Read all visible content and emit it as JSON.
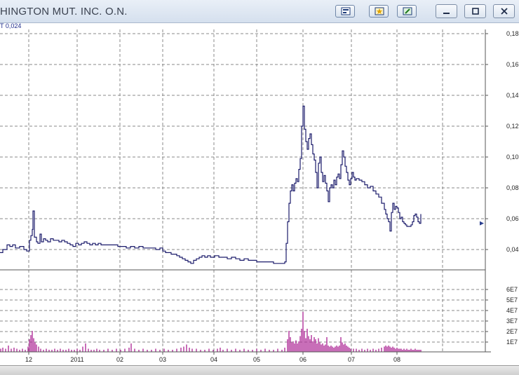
{
  "window": {
    "title": "HINGTON MUT. INC. O.N.",
    "cursor_readout": "T  0,024"
  },
  "toolbar": {
    "buttons": [
      {
        "name": "chart-settings-button",
        "icon": "chart-settings-icon"
      },
      {
        "name": "favorite-button",
        "icon": "star-icon"
      },
      {
        "name": "draw-tool-button",
        "icon": "pencil-icon"
      }
    ],
    "window_controls": [
      "minimize-icon",
      "restore-icon",
      "close-icon"
    ]
  },
  "chart_data": [
    {
      "type": "line",
      "title": "",
      "xlabel": "",
      "ylabel": "",
      "x_ticks": [
        "12",
        "2011",
        "02",
        "03",
        "04",
        "05",
        "06",
        "07",
        "08"
      ],
      "y_ticks": [
        "0,18",
        "0,16",
        "0,14",
        "0,12",
        "0,10",
        "0,08",
        "0,06",
        "0,04"
      ],
      "ylim": [
        0.03,
        0.185
      ],
      "grid": true,
      "last_value_marker": 0.057,
      "price_series": [
        [
          0,
          0.038
        ],
        [
          4,
          0.04
        ],
        [
          8,
          0.04
        ],
        [
          10,
          0.043
        ],
        [
          14,
          0.042
        ],
        [
          18,
          0.043
        ],
        [
          22,
          0.041
        ],
        [
          28,
          0.042
        ],
        [
          34,
          0.04
        ],
        [
          38,
          0.039
        ],
        [
          40,
          0.039
        ],
        [
          42,
          0.046
        ],
        [
          44,
          0.049
        ],
        [
          46,
          0.053
        ],
        [
          47,
          0.065
        ],
        [
          49,
          0.048
        ],
        [
          52,
          0.045
        ],
        [
          54,
          0.044
        ],
        [
          57,
          0.05
        ],
        [
          59,
          0.045
        ],
        [
          62,
          0.047
        ],
        [
          65,
          0.046
        ],
        [
          68,
          0.045
        ],
        [
          72,
          0.047
        ],
        [
          76,
          0.046
        ],
        [
          80,
          0.046
        ],
        [
          84,
          0.045
        ],
        [
          88,
          0.046
        ],
        [
          92,
          0.045
        ],
        [
          96,
          0.044
        ],
        [
          100,
          0.043
        ],
        [
          104,
          0.042
        ],
        [
          108,
          0.044
        ],
        [
          112,
          0.043
        ],
        [
          116,
          0.044
        ],
        [
          120,
          0.045
        ],
        [
          124,
          0.044
        ],
        [
          128,
          0.043
        ],
        [
          132,
          0.044
        ],
        [
          136,
          0.043
        ],
        [
          140,
          0.044
        ],
        [
          144,
          0.043
        ],
        [
          150,
          0.043
        ],
        [
          156,
          0.043
        ],
        [
          162,
          0.043
        ],
        [
          168,
          0.042
        ],
        [
          174,
          0.042
        ],
        [
          180,
          0.041
        ],
        [
          186,
          0.042
        ],
        [
          192,
          0.041
        ],
        [
          198,
          0.042
        ],
        [
          204,
          0.041
        ],
        [
          210,
          0.041
        ],
        [
          216,
          0.041
        ],
        [
          222,
          0.04
        ],
        [
          228,
          0.041
        ],
        [
          232,
          0.039
        ],
        [
          236,
          0.038
        ],
        [
          240,
          0.038
        ],
        [
          244,
          0.037
        ],
        [
          248,
          0.037
        ],
        [
          252,
          0.036
        ],
        [
          256,
          0.035
        ],
        [
          260,
          0.034
        ],
        [
          264,
          0.033
        ],
        [
          268,
          0.032
        ],
        [
          272,
          0.031
        ],
        [
          276,
          0.033
        ],
        [
          280,
          0.034
        ],
        [
          284,
          0.035
        ],
        [
          288,
          0.036
        ],
        [
          292,
          0.035
        ],
        [
          296,
          0.036
        ],
        [
          300,
          0.035
        ],
        [
          306,
          0.036
        ],
        [
          312,
          0.035
        ],
        [
          318,
          0.035
        ],
        [
          324,
          0.034
        ],
        [
          330,
          0.035
        ],
        [
          336,
          0.034
        ],
        [
          342,
          0.033
        ],
        [
          348,
          0.034
        ],
        [
          354,
          0.033
        ],
        [
          360,
          0.033
        ],
        [
          366,
          0.032
        ],
        [
          372,
          0.032
        ],
        [
          378,
          0.032
        ],
        [
          384,
          0.032
        ],
        [
          390,
          0.031
        ],
        [
          396,
          0.031
        ],
        [
          402,
          0.031
        ],
        [
          406,
          0.032
        ],
        [
          408,
          0.044
        ],
        [
          410,
          0.058
        ],
        [
          412,
          0.07
        ],
        [
          414,
          0.078
        ],
        [
          416,
          0.082
        ],
        [
          418,
          0.078
        ],
        [
          420,
          0.083
        ],
        [
          422,
          0.086
        ],
        [
          424,
          0.084
        ],
        [
          426,
          0.092
        ],
        [
          428,
          0.099
        ],
        [
          430,
          0.12
        ],
        [
          432,
          0.133
        ],
        [
          434,
          0.118
        ],
        [
          436,
          0.11
        ],
        [
          438,
          0.105
        ],
        [
          440,
          0.112
        ],
        [
          442,
          0.115
        ],
        [
          444,
          0.108
        ],
        [
          446,
          0.102
        ],
        [
          448,
          0.098
        ],
        [
          450,
          0.09
        ],
        [
          452,
          0.08
        ],
        [
          454,
          0.096
        ],
        [
          456,
          0.1
        ],
        [
          458,
          0.09
        ],
        [
          460,
          0.084
        ],
        [
          462,
          0.088
        ],
        [
          464,
          0.083
        ],
        [
          466,
          0.078
        ],
        [
          468,
          0.071
        ],
        [
          470,
          0.08
        ],
        [
          472,
          0.082
        ],
        [
          474,
          0.08
        ],
        [
          476,
          0.085
        ],
        [
          478,
          0.082
        ],
        [
          480,
          0.087
        ],
        [
          482,
          0.089
        ],
        [
          484,
          0.086
        ],
        [
          486,
          0.095
        ],
        [
          488,
          0.104
        ],
        [
          490,
          0.1
        ],
        [
          492,
          0.094
        ],
        [
          494,
          0.09
        ],
        [
          496,
          0.085
        ],
        [
          498,
          0.082
        ],
        [
          500,
          0.086
        ],
        [
          502,
          0.09
        ],
        [
          504,
          0.087
        ],
        [
          506,
          0.085
        ],
        [
          508,
          0.086
        ],
        [
          512,
          0.085
        ],
        [
          516,
          0.084
        ],
        [
          520,
          0.082
        ],
        [
          524,
          0.08
        ],
        [
          528,
          0.081
        ],
        [
          532,
          0.078
        ],
        [
          536,
          0.076
        ],
        [
          540,
          0.074
        ],
        [
          544,
          0.07
        ],
        [
          548,
          0.066
        ],
        [
          550,
          0.063
        ],
        [
          552,
          0.06
        ],
        [
          554,
          0.058
        ],
        [
          556,
          0.052
        ],
        [
          558,
          0.064
        ],
        [
          560,
          0.07
        ],
        [
          562,
          0.066
        ],
        [
          564,
          0.068
        ],
        [
          566,
          0.067
        ],
        [
          568,
          0.064
        ],
        [
          570,
          0.06
        ],
        [
          572,
          0.061
        ],
        [
          574,
          0.058
        ],
        [
          576,
          0.057
        ],
        [
          578,
          0.056
        ],
        [
          580,
          0.055
        ],
        [
          582,
          0.055
        ],
        [
          584,
          0.055
        ],
        [
          586,
          0.056
        ],
        [
          588,
          0.058
        ],
        [
          590,
          0.062
        ],
        [
          592,
          0.063
        ],
        [
          594,
          0.061
        ],
        [
          596,
          0.058
        ],
        [
          598,
          0.057
        ],
        [
          600,
          0.063
        ]
      ]
    },
    {
      "type": "bar",
      "title": "",
      "y_ticks": [
        "6E7",
        "5E7",
        "4E7",
        "3E7",
        "2E7",
        "1E7"
      ],
      "ylim": [
        0,
        6.5
      ],
      "volume_series": [
        [
          1,
          0.3
        ],
        [
          4,
          0.4
        ],
        [
          8,
          0.3
        ],
        [
          12,
          0.6
        ],
        [
          16,
          0.3
        ],
        [
          20,
          0.4
        ],
        [
          24,
          0.3
        ],
        [
          28,
          0.2
        ],
        [
          32,
          0.3
        ],
        [
          36,
          0.2
        ],
        [
          40,
          0.5
        ],
        [
          42,
          1.2
        ],
        [
          44,
          1.6
        ],
        [
          46,
          2.0
        ],
        [
          48,
          1.3
        ],
        [
          50,
          0.9
        ],
        [
          52,
          0.7
        ],
        [
          55,
          0.5
        ],
        [
          58,
          0.3
        ],
        [
          62,
          0.2
        ],
        [
          66,
          0.3
        ],
        [
          70,
          0.2
        ],
        [
          74,
          0.2
        ],
        [
          78,
          0.3
        ],
        [
          82,
          0.2
        ],
        [
          86,
          0.3
        ],
        [
          90,
          0.2
        ],
        [
          94,
          0.2
        ],
        [
          98,
          0.3
        ],
        [
          102,
          0.2
        ],
        [
          106,
          0.2
        ],
        [
          110,
          0.3
        ],
        [
          114,
          0.2
        ],
        [
          118,
          0.5
        ],
        [
          122,
          0.8
        ],
        [
          126,
          0.3
        ],
        [
          130,
          0.2
        ],
        [
          134,
          0.2
        ],
        [
          138,
          0.3
        ],
        [
          142,
          0.2
        ],
        [
          148,
          0.2
        ],
        [
          154,
          0.3
        ],
        [
          160,
          0.2
        ],
        [
          166,
          0.3
        ],
        [
          172,
          0.2
        ],
        [
          178,
          0.3
        ],
        [
          184,
          0.4
        ],
        [
          187,
          0.8
        ],
        [
          192,
          0.3
        ],
        [
          198,
          0.2
        ],
        [
          204,
          0.3
        ],
        [
          210,
          0.2
        ],
        [
          216,
          0.2
        ],
        [
          222,
          0.3
        ],
        [
          228,
          0.2
        ],
        [
          234,
          0.3
        ],
        [
          240,
          0.2
        ],
        [
          246,
          0.2
        ],
        [
          252,
          0.3
        ],
        [
          258,
          0.4
        ],
        [
          262,
          0.5
        ],
        [
          266,
          0.7
        ],
        [
          270,
          0.4
        ],
        [
          274,
          0.3
        ],
        [
          280,
          0.3
        ],
        [
          286,
          0.2
        ],
        [
          292,
          0.2
        ],
        [
          298,
          0.3
        ],
        [
          304,
          0.2
        ],
        [
          310,
          0.3
        ],
        [
          314,
          0.4
        ],
        [
          318,
          0.2
        ],
        [
          324,
          0.3
        ],
        [
          330,
          0.2
        ],
        [
          336,
          0.3
        ],
        [
          342,
          0.2
        ],
        [
          348,
          0.3
        ],
        [
          354,
          0.2
        ],
        [
          360,
          0.2
        ],
        [
          366,
          0.3
        ],
        [
          372,
          0.2
        ],
        [
          378,
          0.3
        ],
        [
          384,
          0.2
        ],
        [
          390,
          0.2
        ],
        [
          396,
          0.3
        ],
        [
          402,
          0.2
        ],
        [
          406,
          0.4
        ],
        [
          410,
          1.2
        ],
        [
          412,
          2.0
        ],
        [
          414,
          1.4
        ],
        [
          416,
          0.9
        ],
        [
          418,
          1.0
        ],
        [
          420,
          0.8
        ],
        [
          422,
          1.1
        ],
        [
          424,
          0.8
        ],
        [
          426,
          1.0
        ],
        [
          428,
          1.5
        ],
        [
          430,
          2.2
        ],
        [
          432,
          3.8
        ],
        [
          434,
          2.0
        ],
        [
          436,
          1.3
        ],
        [
          438,
          2.2
        ],
        [
          440,
          1.5
        ],
        [
          442,
          1.2
        ],
        [
          444,
          1.6
        ],
        [
          446,
          1.0
        ],
        [
          448,
          1.4
        ],
        [
          450,
          1.2
        ],
        [
          452,
          0.8
        ],
        [
          454,
          1.3
        ],
        [
          456,
          0.9
        ],
        [
          458,
          0.7
        ],
        [
          460,
          0.8
        ],
        [
          462,
          0.6
        ],
        [
          464,
          0.7
        ],
        [
          466,
          1.4
        ],
        [
          468,
          0.6
        ],
        [
          470,
          0.5
        ],
        [
          472,
          0.6
        ],
        [
          474,
          0.5
        ],
        [
          476,
          0.4
        ],
        [
          478,
          0.5
        ],
        [
          480,
          0.6
        ],
        [
          482,
          0.5
        ],
        [
          484,
          0.6
        ],
        [
          486,
          1.4
        ],
        [
          488,
          0.9
        ],
        [
          490,
          0.7
        ],
        [
          492,
          0.8
        ],
        [
          494,
          0.6
        ],
        [
          496,
          0.5
        ],
        [
          498,
          0.4
        ],
        [
          500,
          0.3
        ],
        [
          504,
          0.3
        ],
        [
          508,
          0.3
        ],
        [
          512,
          0.2
        ],
        [
          516,
          0.3
        ],
        [
          520,
          0.2
        ],
        [
          524,
          0.3
        ],
        [
          528,
          0.2
        ],
        [
          532,
          0.3
        ],
        [
          536,
          0.2
        ],
        [
          540,
          0.3
        ],
        [
          544,
          0.4
        ],
        [
          548,
          0.5
        ],
        [
          550,
          0.6
        ],
        [
          552,
          0.5
        ],
        [
          554,
          0.6
        ],
        [
          556,
          0.5
        ],
        [
          558,
          0.4
        ],
        [
          560,
          0.5
        ],
        [
          562,
          0.4
        ],
        [
          564,
          0.3
        ],
        [
          566,
          0.4
        ],
        [
          568,
          0.3
        ],
        [
          570,
          0.3
        ],
        [
          572,
          0.3
        ],
        [
          574,
          0.2
        ],
        [
          576,
          0.3
        ],
        [
          578,
          0.2
        ],
        [
          580,
          0.3
        ],
        [
          582,
          0.2
        ],
        [
          584,
          0.2
        ],
        [
          586,
          0.3
        ],
        [
          588,
          0.2
        ],
        [
          590,
          0.2
        ],
        [
          592,
          0.3
        ],
        [
          594,
          0.2
        ],
        [
          596,
          0.2
        ],
        [
          598,
          0.2
        ],
        [
          600,
          0.2
        ]
      ]
    }
  ],
  "colors": {
    "price_line": "#1b1b6b",
    "volume_bar": "#b0309a",
    "grid": "#8a8a8a",
    "marker": "#2a3f8f"
  }
}
